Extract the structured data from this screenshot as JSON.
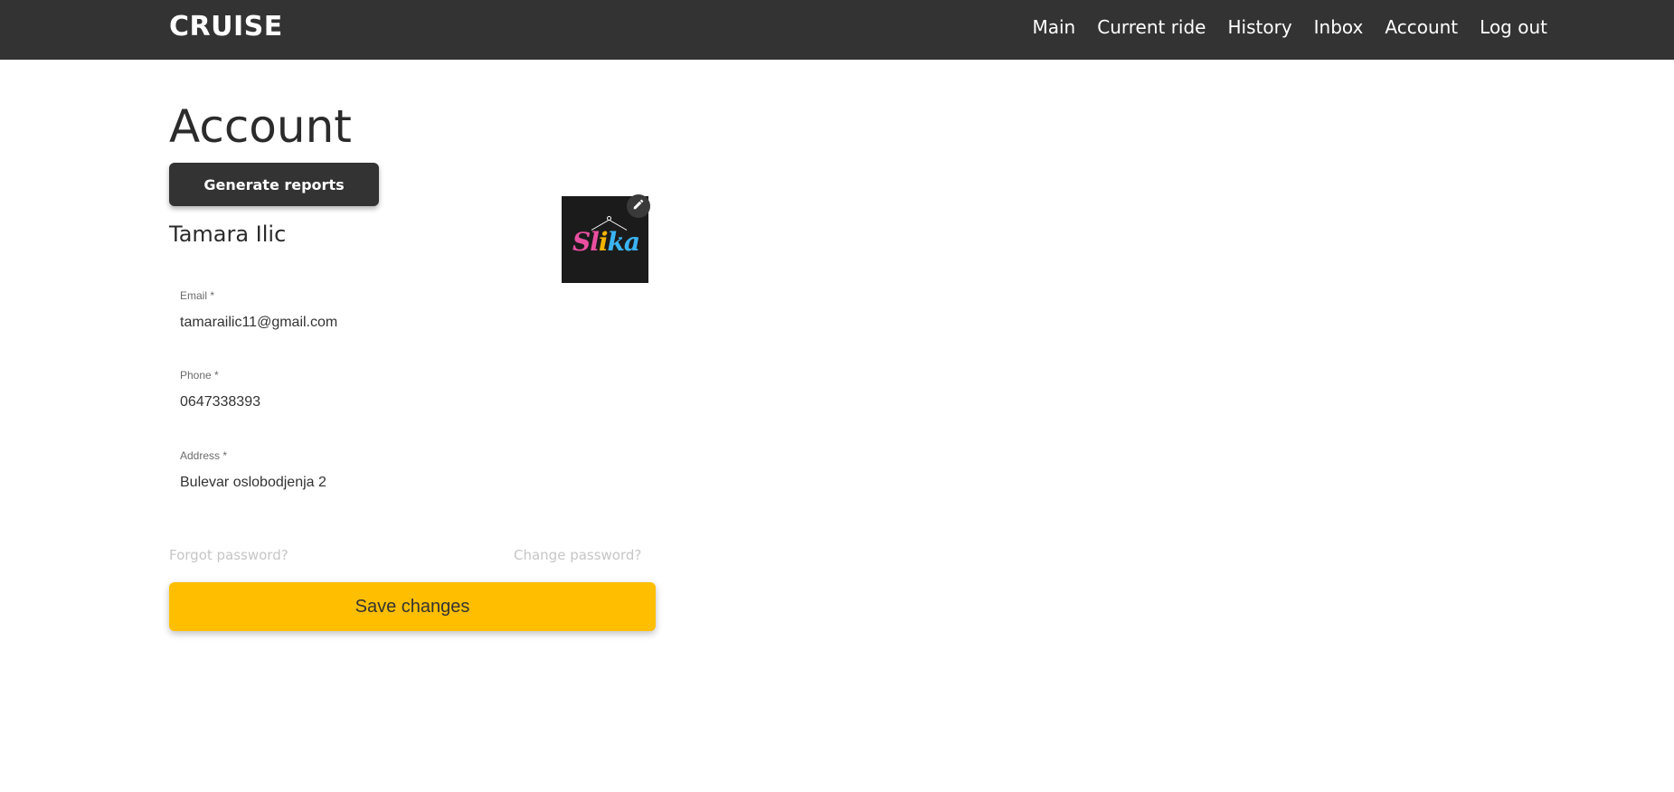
{
  "app": {
    "brand": "CRUISE"
  },
  "nav": {
    "items": [
      "Main",
      "Current ride",
      "History",
      "Inbox",
      "Account",
      "Log out"
    ]
  },
  "page": {
    "title": "Account",
    "generate_reports_label": "Generate reports",
    "user_name": "Tamara Ilic",
    "avatar": {
      "text_parts": [
        "Sl",
        "i",
        "ka"
      ],
      "edit_icon": "pencil-icon"
    }
  },
  "form": {
    "email": {
      "label": "Email *",
      "value": "tamarailic11@gmail.com"
    },
    "phone": {
      "label": "Phone *",
      "value": "0647338393"
    },
    "address": {
      "label": "Address *",
      "value": "Bulevar oslobodjenja 2"
    }
  },
  "links": {
    "forgot_password": "Forgot password?",
    "change_password": "Change password?"
  },
  "actions": {
    "save_label": "Save changes"
  },
  "colors": {
    "navbar_bg": "#333333",
    "primary_button": "#ffbe00",
    "dark_button": "#333333",
    "muted_link": "#c6c6c6"
  }
}
